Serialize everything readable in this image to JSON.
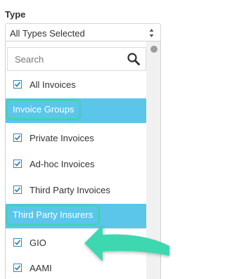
{
  "field": {
    "label": "Type"
  },
  "select": {
    "value": "All Types Selected"
  },
  "search": {
    "placeholder": "Search"
  },
  "options": [
    {
      "label": "All Invoices",
      "checked": true
    },
    {
      "group": "Invoice Groups"
    },
    {
      "label": "Private Invoices",
      "checked": true
    },
    {
      "label": "Ad-hoc Invoices",
      "checked": true
    },
    {
      "label": "Third Party Invoices",
      "checked": true
    },
    {
      "group": "Third Party Insurers"
    },
    {
      "label": "GIO",
      "checked": true
    },
    {
      "label": "AAMI",
      "checked": true
    }
  ],
  "colors": {
    "group_bg": "#5bc6ea",
    "highlight": "#3ed8b0",
    "checkbox": "#3a87ad"
  }
}
